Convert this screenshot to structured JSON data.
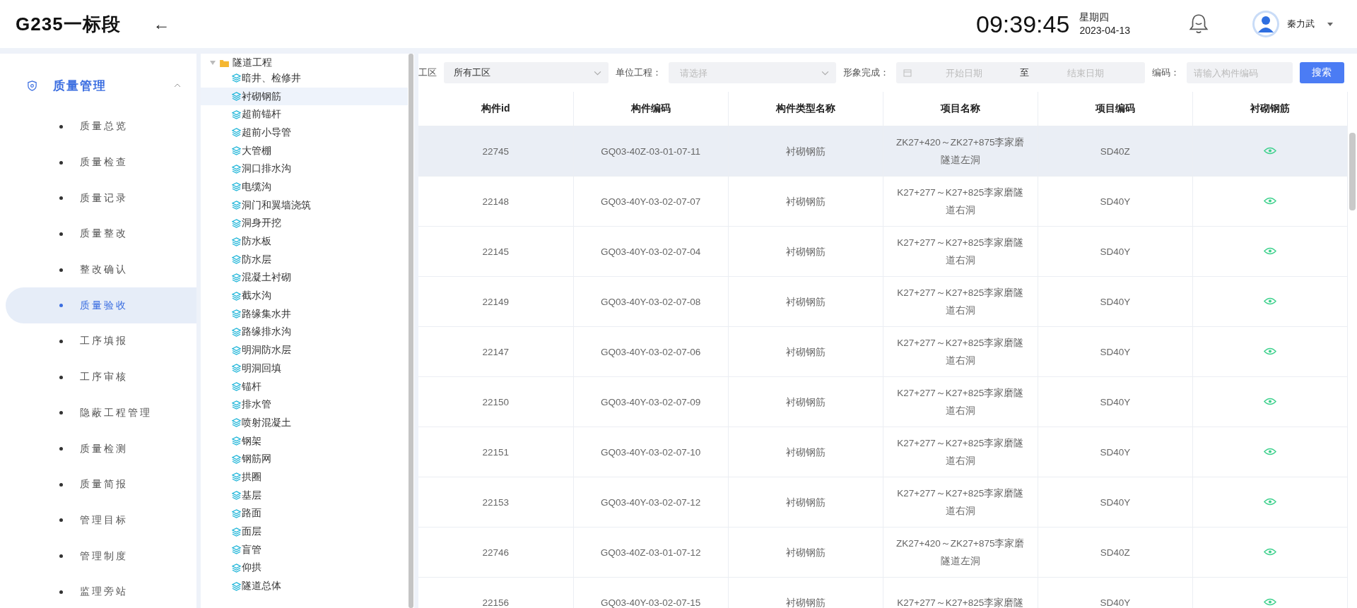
{
  "header": {
    "title": "G235一标段",
    "back": "←",
    "time": "09:39:45",
    "weekday": "星期四",
    "date": "2023-04-13",
    "user": "秦力武"
  },
  "sidebar": {
    "group": {
      "label": "质量管理",
      "expanded": true
    },
    "items": [
      {
        "label": "质量总览",
        "selected": false
      },
      {
        "label": "质量检查",
        "selected": false
      },
      {
        "label": "质量记录",
        "selected": false
      },
      {
        "label": "质量整改",
        "selected": false
      },
      {
        "label": "整改确认",
        "selected": false
      },
      {
        "label": "质量验收",
        "selected": true
      },
      {
        "label": "工序填报",
        "selected": false
      },
      {
        "label": "工序审核",
        "selected": false
      },
      {
        "label": "隐蔽工程管理",
        "selected": false
      },
      {
        "label": "质量检测",
        "selected": false
      },
      {
        "label": "质量简报",
        "selected": false
      },
      {
        "label": "管理目标",
        "selected": false
      },
      {
        "label": "管理制度",
        "selected": false
      },
      {
        "label": "监理旁站",
        "selected": false
      }
    ]
  },
  "tree": {
    "label": "隧道工程",
    "expanded": true,
    "children": [
      {
        "label": "暗井、检修井",
        "selected": false
      },
      {
        "label": "衬砌钢筋",
        "selected": true
      },
      {
        "label": "超前锚杆",
        "selected": false
      },
      {
        "label": "超前小导管",
        "selected": false
      },
      {
        "label": "大管棚",
        "selected": false
      },
      {
        "label": "洞口排水沟",
        "selected": false
      },
      {
        "label": "电缆沟",
        "selected": false
      },
      {
        "label": "洞门和翼墙浇筑",
        "selected": false
      },
      {
        "label": "洞身开挖",
        "selected": false
      },
      {
        "label": "防水板",
        "selected": false
      },
      {
        "label": "防水层",
        "selected": false
      },
      {
        "label": "混凝土衬砌",
        "selected": false
      },
      {
        "label": "截水沟",
        "selected": false
      },
      {
        "label": "路缘集水井",
        "selected": false
      },
      {
        "label": "路缘排水沟",
        "selected": false
      },
      {
        "label": "明洞防水层",
        "selected": false
      },
      {
        "label": "明洞回填",
        "selected": false
      },
      {
        "label": "锚杆",
        "selected": false
      },
      {
        "label": "排水管",
        "selected": false
      },
      {
        "label": "喷射混凝土",
        "selected": false
      },
      {
        "label": "钢架",
        "selected": false
      },
      {
        "label": "钢筋网",
        "selected": false
      },
      {
        "label": "拱圈",
        "selected": false
      },
      {
        "label": "基层",
        "selected": false
      },
      {
        "label": "路面",
        "selected": false
      },
      {
        "label": "面层",
        "selected": false
      },
      {
        "label": "盲管",
        "selected": false
      },
      {
        "label": "仰拱",
        "selected": false
      },
      {
        "label": "隧道总体",
        "selected": false
      }
    ]
  },
  "filters": {
    "work_area": {
      "label": "工区",
      "value": "所有工区"
    },
    "unit": {
      "label": "单位工程：",
      "placeholder": "请选择"
    },
    "completion": {
      "label": "形象完成：",
      "start_placeholder": "开始日期",
      "separator": "至",
      "end_placeholder": "结束日期"
    },
    "code": {
      "label": "编码：",
      "placeholder": "请输入构件编码"
    },
    "search_button": "搜索"
  },
  "table": {
    "columns": [
      "构件id",
      "构件编码",
      "构件类型名称",
      "项目名称",
      "项目编码",
      "衬砌钢筋"
    ],
    "rows": [
      {
        "id": "22745",
        "code": "GQ03-40Z-03-01-07-11",
        "type": "衬砌钢筋",
        "project": "ZK27+420～ZK27+875李家磨隧道左洞",
        "project_code": "SD40Z",
        "hovered": true
      },
      {
        "id": "22148",
        "code": "GQ03-40Y-03-02-07-07",
        "type": "衬砌钢筋",
        "project": "K27+277～K27+825李家磨隧道右洞",
        "project_code": "SD40Y",
        "hovered": false
      },
      {
        "id": "22145",
        "code": "GQ03-40Y-03-02-07-04",
        "type": "衬砌钢筋",
        "project": "K27+277～K27+825李家磨隧道右洞",
        "project_code": "SD40Y",
        "hovered": false
      },
      {
        "id": "22149",
        "code": "GQ03-40Y-03-02-07-08",
        "type": "衬砌钢筋",
        "project": "K27+277～K27+825李家磨隧道右洞",
        "project_code": "SD40Y",
        "hovered": false
      },
      {
        "id": "22147",
        "code": "GQ03-40Y-03-02-07-06",
        "type": "衬砌钢筋",
        "project": "K27+277～K27+825李家磨隧道右洞",
        "project_code": "SD40Y",
        "hovered": false
      },
      {
        "id": "22150",
        "code": "GQ03-40Y-03-02-07-09",
        "type": "衬砌钢筋",
        "project": "K27+277～K27+825李家磨隧道右洞",
        "project_code": "SD40Y",
        "hovered": false
      },
      {
        "id": "22151",
        "code": "GQ03-40Y-03-02-07-10",
        "type": "衬砌钢筋",
        "project": "K27+277～K27+825李家磨隧道右洞",
        "project_code": "SD40Y",
        "hovered": false
      },
      {
        "id": "22153",
        "code": "GQ03-40Y-03-02-07-12",
        "type": "衬砌钢筋",
        "project": "K27+277～K27+825李家磨隧道右洞",
        "project_code": "SD40Y",
        "hovered": false
      },
      {
        "id": "22746",
        "code": "GQ03-40Z-03-01-07-12",
        "type": "衬砌钢筋",
        "project": "ZK27+420～ZK27+875李家磨隧道左洞",
        "project_code": "SD40Z",
        "hovered": false
      },
      {
        "id": "22156",
        "code": "GQ03-40Y-03-02-07-15",
        "type": "衬砌钢筋",
        "project": "K27+277～K27+825李家磨隧",
        "project_code": "SD40Y",
        "hovered": false
      }
    ]
  }
}
